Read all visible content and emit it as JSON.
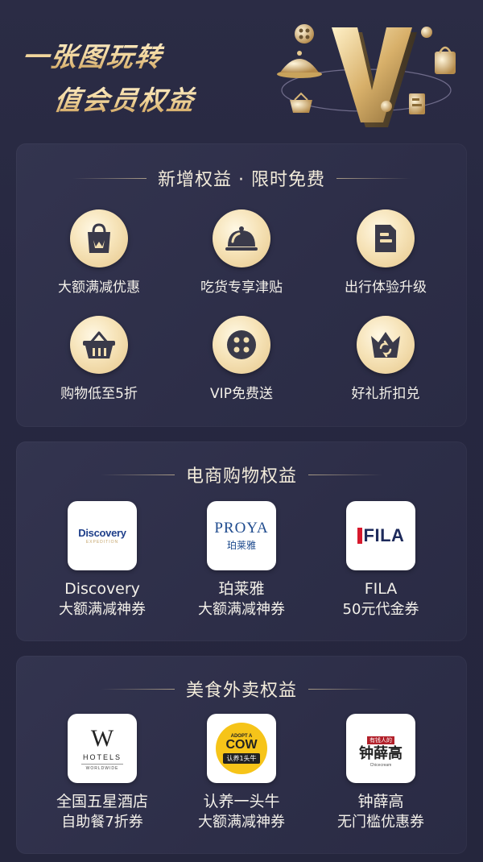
{
  "header": {
    "title_line1": "一张图玩转",
    "title_line2": "值会员权益"
  },
  "sections": [
    {
      "title": "新增权益 · 限时免费",
      "benefits": [
        {
          "label": "大额满减优惠",
          "icon": "shopping-bag-icon"
        },
        {
          "label": "吃货专享津贴",
          "icon": "food-cloche-icon"
        },
        {
          "label": "出行体验升级",
          "icon": "document-icon"
        },
        {
          "label": "购物低至5折",
          "icon": "shopping-basket-icon"
        },
        {
          "label": "VIP免费送",
          "icon": "film-reel-icon"
        },
        {
          "label": "好礼折扣兑",
          "icon": "crown-exchange-icon"
        }
      ]
    },
    {
      "title": "电商购物权益",
      "brands": [
        {
          "name": "Discovery",
          "offer": "大额满减神券",
          "logo_text": "Discovery",
          "logo_sub": "EXPEDITION"
        },
        {
          "name": "珀莱雅",
          "offer": "大额满减神券",
          "logo_text": "PROYA",
          "logo_sub": "珀莱雅"
        },
        {
          "name": "FILA",
          "offer": "50元代金券",
          "logo_text": "FILA"
        }
      ]
    },
    {
      "title": "美食外卖权益",
      "brands": [
        {
          "name": "全国五星酒店",
          "offer": "自助餐7折券",
          "logo_text": "W",
          "logo_sub": "HOTELS",
          "logo_sub2": "WORLDWIDE"
        },
        {
          "name": "认养一头牛",
          "offer": "大额满减神券",
          "logo_text": "COW",
          "logo_sub": "认养1头牛",
          "logo_top": "ADOPT A"
        },
        {
          "name": "钟薛高",
          "offer": "无门槛优惠券",
          "logo_text": "钟薛高",
          "logo_sub": "Chicecream",
          "logo_top": "有钱人的"
        }
      ]
    }
  ],
  "colors": {
    "background": "#262740",
    "panel": "#2f3049",
    "gold": "#f0d49a",
    "icon_dark": "#3a3a4a",
    "fila_red": "#d7192d",
    "fila_navy": "#1d2a5b",
    "proya_blue": "#1f4b8e",
    "cow_yellow": "#f6c419"
  }
}
